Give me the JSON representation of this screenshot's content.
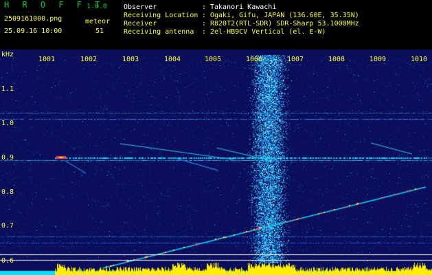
{
  "header": {
    "app_title": "H R O F F T",
    "version": "1.0.0",
    "filename": "2509161000.png",
    "timestamp": "25.09.16 10:00",
    "meteor_label": "meteor",
    "meteor_count": "51",
    "fields": [
      {
        "label": "Observer",
        "sep": ":",
        "value": "Takanori Kawachi"
      },
      {
        "label": "Receiving Location",
        "sep": ":",
        "value": "Ogaki, Gifu, JAPAN (136.60E, 35.35N)"
      },
      {
        "label": "Receiver",
        "sep": ":",
        "value": "R820T2(RTL-SDR) SDR-Sharp 53.1000MHz"
      },
      {
        "label": "Receiving antenna",
        "sep": ":",
        "value": "2el-HB9CV Vertical (el. E-W)"
      }
    ]
  },
  "spectrogram": {
    "y_unit": "kHz",
    "time_ticks": [
      "1001",
      "1002",
      "1003",
      "1004",
      "1005",
      "1006",
      "1007",
      "1008",
      "1009",
      "1010"
    ],
    "freq_ticks": [
      "1.1",
      "1.0",
      "0.9",
      "0.8",
      "0.7",
      "0.6"
    ],
    "colors": {
      "background": "#0b0e5a",
      "axis_text": "#ffff33",
      "signal": "#00e0ff",
      "meteor": "#ff4040",
      "level_bar": "#ffee00",
      "baseline": "#00e0ff"
    }
  }
}
